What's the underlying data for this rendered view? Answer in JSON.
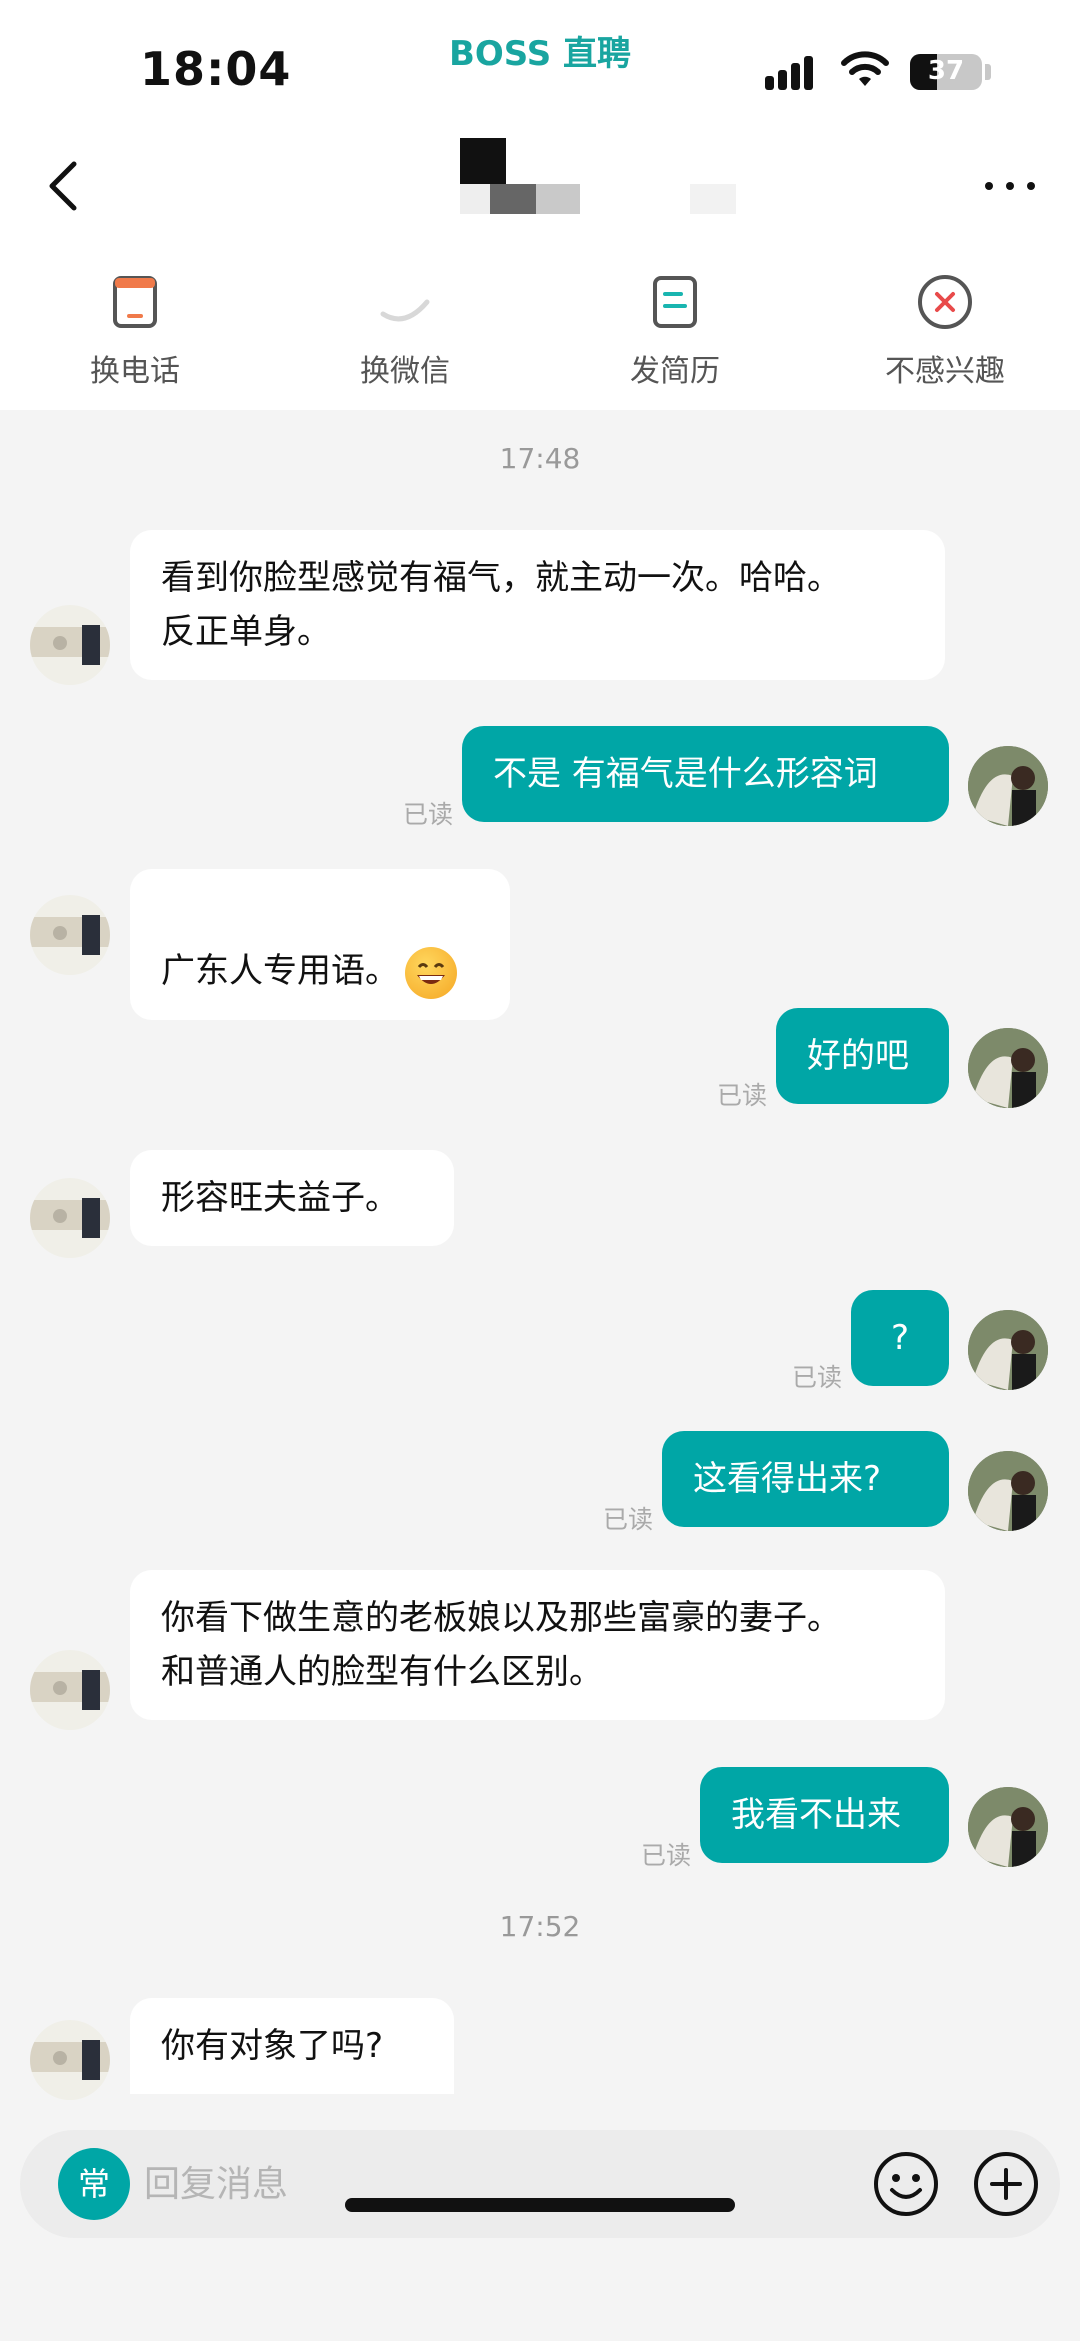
{
  "status_bar": {
    "time": "18:04",
    "app_brand": "BOSS 直聘",
    "battery_percent": 37,
    "battery_label": "37",
    "icons": [
      "signal-icon",
      "wifi-icon",
      "battery-icon"
    ]
  },
  "header": {
    "back_icon": "chevron-left-icon",
    "more_icon": "more-horizontal-icon"
  },
  "actions": [
    {
      "label": "换电话",
      "icon": "phone-swap-icon"
    },
    {
      "label": "换微信",
      "icon": "wechat-swap-icon"
    },
    {
      "label": "发简历",
      "icon": "resume-icon"
    },
    {
      "label": "不感兴趣",
      "icon": "not-interested-icon"
    }
  ],
  "chat": {
    "timestamps": [
      "17:48",
      "17:52"
    ],
    "read_label": "已读",
    "messages": [
      {
        "from": "recruiter",
        "text": "看到你脸型感觉有福气，就主动一次。哈哈。\n反正单身。"
      },
      {
        "from": "me",
        "text": "不是 有福气是什么形容词",
        "status": "已读"
      },
      {
        "from": "recruiter",
        "text": "广东人专用语。",
        "emoji": "grinning-face"
      },
      {
        "from": "me",
        "text": "好的吧",
        "status": "已读"
      },
      {
        "from": "recruiter",
        "text": "形容旺夫益子。"
      },
      {
        "from": "me",
        "text": "?",
        "status": "已读"
      },
      {
        "from": "me",
        "text": "这看得出来?",
        "status": "已读"
      },
      {
        "from": "recruiter",
        "text": "你看下做生意的老板娘以及那些富豪的妻子。\n和普通人的脸型有什么区别。"
      },
      {
        "from": "me",
        "text": "我看不出来",
        "status": "已读"
      },
      {
        "from": "recruiter",
        "text": "你有对象了吗?"
      }
    ]
  },
  "input_bar": {
    "quick_reply_label": "常",
    "placeholder": "回复消息",
    "value": "",
    "emoji_icon": "smiley-icon",
    "plus_icon": "plus-icon"
  },
  "colors": {
    "accent": "#00a6a6",
    "brand": "#19a5a0",
    "background": "#f4f4f4",
    "incoming_bubble": "#ffffff"
  }
}
